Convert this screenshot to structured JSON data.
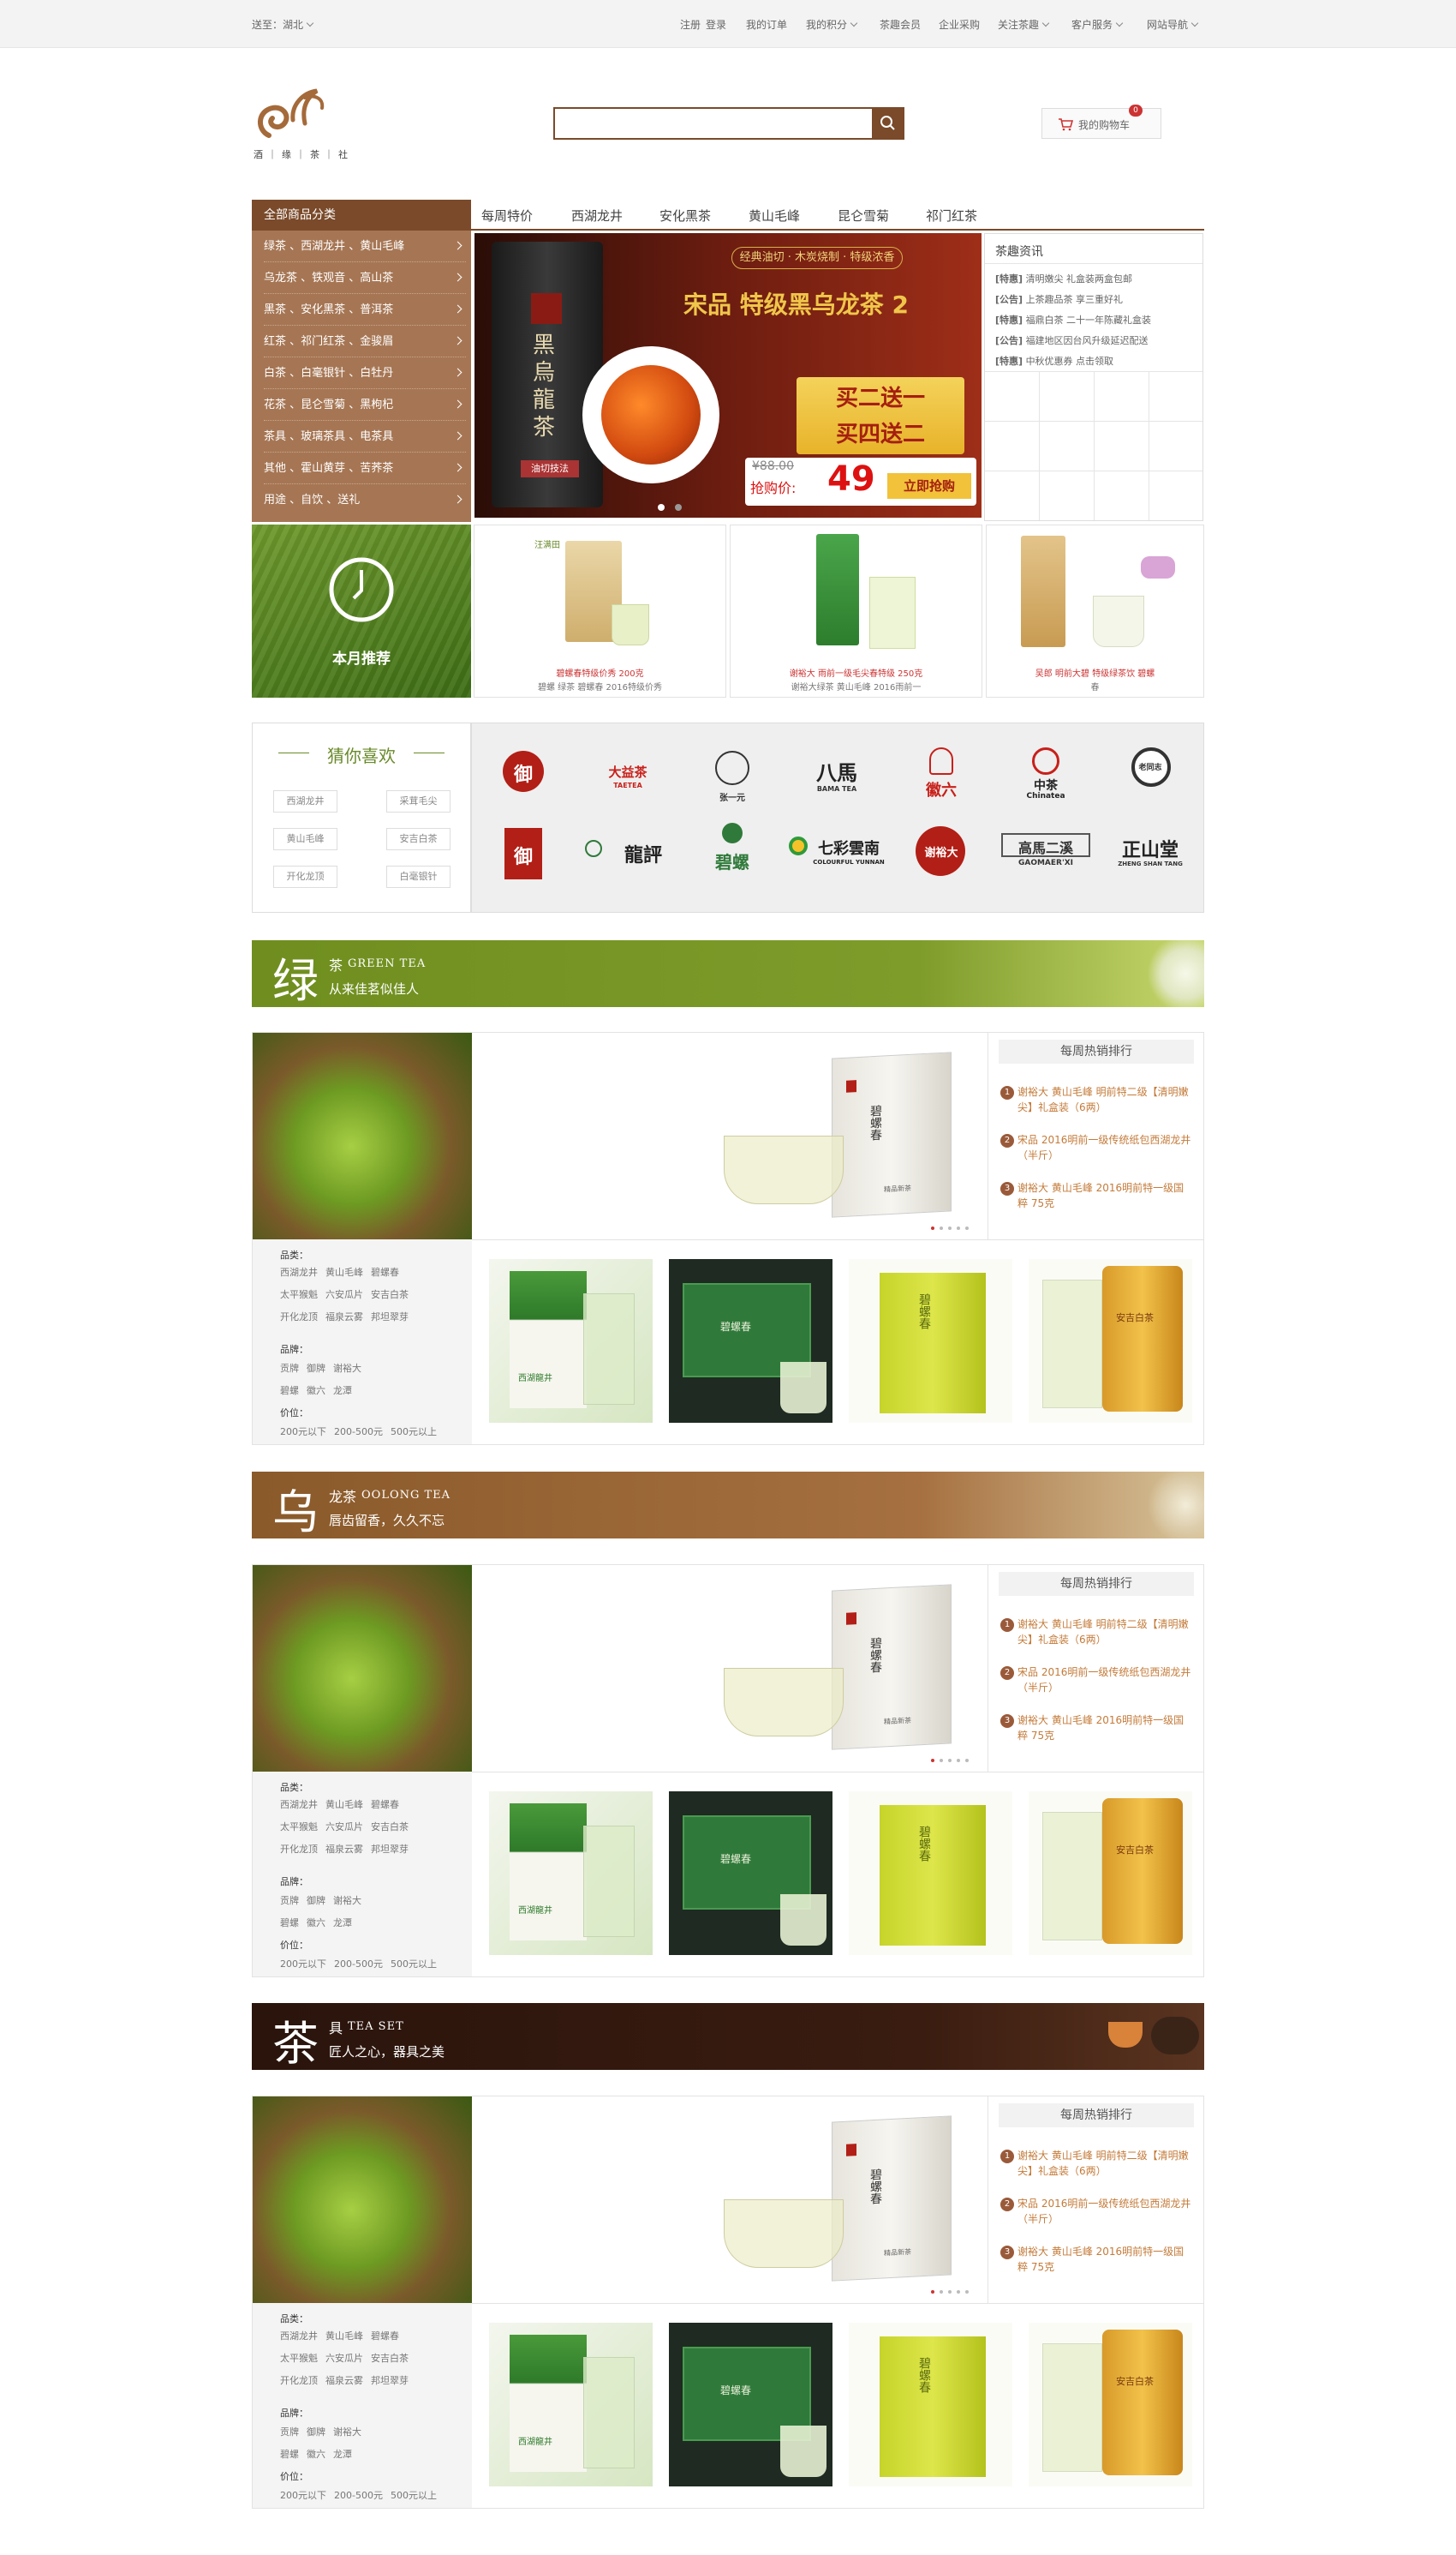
{
  "topbar": {
    "location_label": "送至：湖北",
    "links": [
      "注册",
      "登录",
      "我的订单",
      "我的积分",
      "茶趣会员",
      "企业采购",
      "关注茶趣",
      "客户服务",
      "网站导航"
    ]
  },
  "logo": {
    "text": "酒 ｜ 缘 ｜ 茶 ｜ 社"
  },
  "search": {
    "placeholder": ""
  },
  "cart": {
    "label": "我的购物车",
    "count": "0"
  },
  "nav": {
    "all_categories": "全部商品分类",
    "tabs": [
      "每周特价",
      "西湖龙井",
      "安化黑茶",
      "黄山毛峰",
      "昆仑雪菊",
      "祁门红茶"
    ]
  },
  "categories": [
    "绿茶 、西湖龙井 、黄山毛峰",
    "乌龙茶 、铁观音 、高山茶",
    "黑茶 、安化黑茶 、普洱茶",
    "红茶 、祁门红茶 、金骏眉",
    "白茶 、白毫银针 、白牡丹",
    "花茶 、昆仑雪菊 、黑枸杞",
    "茶具 、玻璃茶具 、电茶具",
    "其他 、霍山黄芽 、苦荞茶",
    "用途 、自饮 、送礼"
  ],
  "banner": {
    "pill": "经典油切 · 木炭烧制 · 特级浓香",
    "headline": "宋品 特级黑乌龙茶 2",
    "box_text": "黑烏龍茶",
    "box_sub": "油切技法",
    "promo1": "买二送一",
    "promo2": "买四送二",
    "old_price": "¥88.00",
    "price_label": "抢购价:",
    "price": "49",
    "buy_btn": "立即抢购"
  },
  "news": {
    "title": "茶趣资讯",
    "items": [
      {
        "tag": "[特惠]",
        "text": "清明嫩尖 礼盒装两盒包邮"
      },
      {
        "tag": "[公告]",
        "text": "上茶趣品茶 享三重好礼"
      },
      {
        "tag": "[特惠]",
        "text": "福鼎白茶 二十一年陈藏礼盒装"
      },
      {
        "tag": "[公告]",
        "text": "福建地区因台风升级延迟配送"
      },
      {
        "tag": "[特惠]",
        "text": "中秋优惠券 点击领取"
      }
    ]
  },
  "month_pick": {
    "label": "本月推荐"
  },
  "featured": [
    {
      "brand": "汪满田",
      "line1": "碧螺春特级价秀 200克",
      "line2": "碧螺 绿茶 碧螺春 2016特级价秀"
    },
    {
      "brand": "谢裕大",
      "line1": "谢裕大 雨前一级毛尖春特级 250克",
      "line2": "谢裕大绿茶 黄山毛峰 2016雨前一"
    },
    {
      "brand": "吴郎",
      "line1": "吴郎 明前大碧 特级绿茶饮 碧螺",
      "line2": "春"
    }
  ],
  "guess": {
    "title": "猜你喜欢",
    "tags": [
      "西湖龙井",
      "采茸毛尖",
      "黄山毛峰",
      "安吉白茶",
      "开化龙顶",
      "白毫银针"
    ]
  },
  "brands": [
    {
      "name": "御",
      "sub": ""
    },
    {
      "name": "大益茶",
      "sub": "TAETEA"
    },
    {
      "name": "张一元",
      "sub": ""
    },
    {
      "name": "八馬",
      "sub": "BAMA TEA"
    },
    {
      "name": "徽六",
      "sub": ""
    },
    {
      "name": "中茶",
      "sub": "Chinatea"
    },
    {
      "name": "老同志",
      "sub": ""
    },
    {
      "name": "御",
      "sub": ""
    },
    {
      "name": "龍評",
      "sub": ""
    },
    {
      "name": "碧螺",
      "sub": ""
    },
    {
      "name": "七彩雲南",
      "sub": "COLOURFUL YUNNAN"
    },
    {
      "name": "谢裕大",
      "sub": ""
    },
    {
      "name": "高馬二溪",
      "sub": "GAOMAER'XI"
    },
    {
      "name": "正山堂",
      "sub": "ZHENG SHAN TANG"
    }
  ],
  "sections": [
    {
      "big": "绿",
      "cn": "茶",
      "en": "GREEN TEA",
      "slogan": "从来佳茗似佳人",
      "theme": "green"
    },
    {
      "big": "乌",
      "cn": "龙茶",
      "en": "OOLONG TEA",
      "slogan": "唇齿留香，久久不忘",
      "theme": "brown"
    },
    {
      "big": "茶",
      "cn": "具",
      "en": "TEA SET",
      "slogan": "匠人之心，器具之美",
      "theme": "dark"
    }
  ],
  "section_side": {
    "type_label": "品类：",
    "types": [
      [
        "西湖龙井",
        "黄山毛峰",
        "碧螺春"
      ],
      [
        "太平猴魁",
        "六安瓜片",
        "安吉白茶"
      ],
      [
        "开化龙顶",
        "福泉云雾",
        "邦坦翠芽"
      ]
    ],
    "brand_label": "品牌：",
    "brands": [
      [
        "贡牌",
        "御牌",
        "谢裕大"
      ],
      [
        "碧螺",
        "徽六",
        "龙潭"
      ]
    ],
    "price_label": "价位：",
    "prices": [
      "200元以下",
      "200-500元",
      "500元以上"
    ]
  },
  "rank": {
    "title": "每周热销排行",
    "items": [
      {
        "num": "1",
        "text": "谢裕大 黄山毛峰 明前特二级【清明嫩尖】礼盒装（6两）"
      },
      {
        "num": "2",
        "text": "宋品 2016明前一级传统纸包西湖龙井（半斤）"
      },
      {
        "num": "3",
        "text": "谢裕大 黄山毛峰 2016明前特一级国粹 75克"
      }
    ]
  },
  "hero": {
    "box_title": "碧螺春",
    "box_small": "精品新茶"
  },
  "thumbs": [
    {
      "label": "西湖龍井",
      "theme": "green-white"
    },
    {
      "label": "碧螺春",
      "theme": "dark-green"
    },
    {
      "label": "碧螺春",
      "theme": "lime"
    },
    {
      "label": "安吉白茶",
      "theme": "gold"
    }
  ],
  "colors": {
    "brand": "#7a4a2a",
    "menu": "#a67654",
    "accent": "#c47b3a",
    "green": "#6d9a22"
  }
}
